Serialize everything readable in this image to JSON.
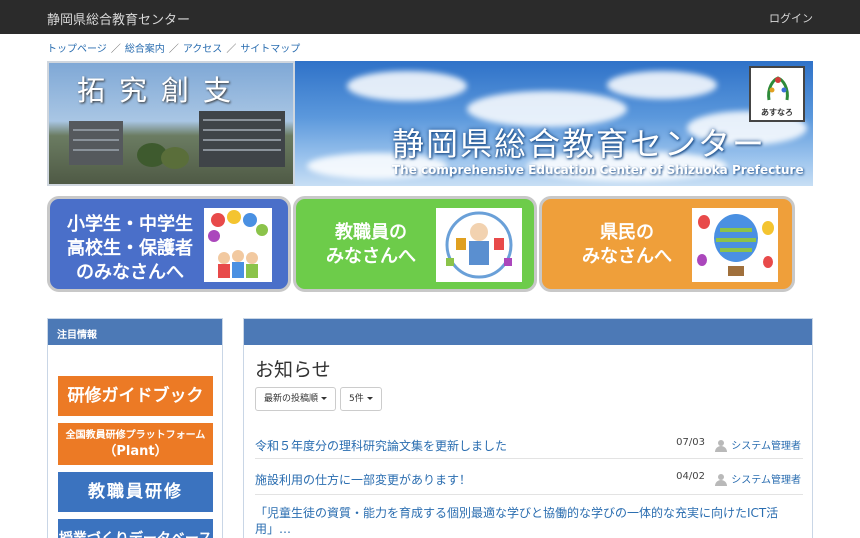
{
  "header": {
    "site_title": "静岡県総合教育センター",
    "login": "ログイン"
  },
  "breadcrumb": [
    "トップページ",
    "総合案内",
    "アクセス",
    "サイトマップ"
  ],
  "banner": {
    "kanji": "拓究創支",
    "title": "静岡県総合教育センター",
    "subtitle": "The comprehensive Education Center of Shizuoka Prefecture",
    "mascot_label": "あすなろ"
  },
  "audience": {
    "students": [
      "小学生・中学生",
      "高校生・保護者",
      "のみなさんへ"
    ],
    "teachers": [
      "教職員の",
      "みなさんへ"
    ],
    "citizens": [
      "県民の",
      "みなさんへ"
    ]
  },
  "sidebar": {
    "title": "注目情報",
    "items": [
      "研修ガイドブック",
      "全国教員研修プラットフォーム",
      "（Plant）",
      "教職員研修",
      "授業づくりデータベース"
    ]
  },
  "news": {
    "title": "お知らせ",
    "sort_label": "最新の投稿順",
    "count_label": "5件",
    "items": [
      {
        "title": "令和５年度分の理科研究論文集を更新しました",
        "date": "07/03",
        "author": "システム管理者"
      },
      {
        "title": "施設利用の仕方に一部変更があります！",
        "date": "04/02",
        "author": "システム管理者"
      },
      {
        "title": "「児童生徒の資質・能力を育成する個別最適な学びと協働的な学びの一体的な充実に向けたICT活用」…",
        "date": "",
        "author": ""
      }
    ]
  }
}
